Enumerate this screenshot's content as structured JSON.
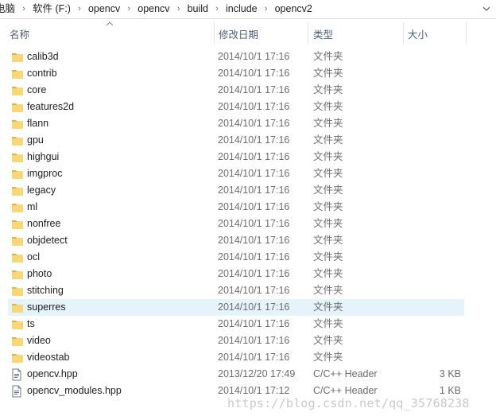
{
  "breadcrumb": [
    "电脑",
    "软件 (F:)",
    "opencv",
    "opencv",
    "build",
    "include",
    "opencv2"
  ],
  "columns": {
    "name": "名称",
    "date": "修改日期",
    "type": "类型",
    "size": "大小"
  },
  "files": [
    {
      "name": "calib3d",
      "date": "2014/10/1 17:16",
      "type": "文件夹",
      "size": "",
      "kind": "folder"
    },
    {
      "name": "contrib",
      "date": "2014/10/1 17:16",
      "type": "文件夹",
      "size": "",
      "kind": "folder"
    },
    {
      "name": "core",
      "date": "2014/10/1 17:16",
      "type": "文件夹",
      "size": "",
      "kind": "folder"
    },
    {
      "name": "features2d",
      "date": "2014/10/1 17:16",
      "type": "文件夹",
      "size": "",
      "kind": "folder"
    },
    {
      "name": "flann",
      "date": "2014/10/1 17:16",
      "type": "文件夹",
      "size": "",
      "kind": "folder"
    },
    {
      "name": "gpu",
      "date": "2014/10/1 17:16",
      "type": "文件夹",
      "size": "",
      "kind": "folder"
    },
    {
      "name": "highgui",
      "date": "2014/10/1 17:16",
      "type": "文件夹",
      "size": "",
      "kind": "folder"
    },
    {
      "name": "imgproc",
      "date": "2014/10/1 17:16",
      "type": "文件夹",
      "size": "",
      "kind": "folder"
    },
    {
      "name": "legacy",
      "date": "2014/10/1 17:16",
      "type": "文件夹",
      "size": "",
      "kind": "folder"
    },
    {
      "name": "ml",
      "date": "2014/10/1 17:16",
      "type": "文件夹",
      "size": "",
      "kind": "folder"
    },
    {
      "name": "nonfree",
      "date": "2014/10/1 17:16",
      "type": "文件夹",
      "size": "",
      "kind": "folder"
    },
    {
      "name": "objdetect",
      "date": "2014/10/1 17:16",
      "type": "文件夹",
      "size": "",
      "kind": "folder"
    },
    {
      "name": "ocl",
      "date": "2014/10/1 17:16",
      "type": "文件夹",
      "size": "",
      "kind": "folder"
    },
    {
      "name": "photo",
      "date": "2014/10/1 17:16",
      "type": "文件夹",
      "size": "",
      "kind": "folder"
    },
    {
      "name": "stitching",
      "date": "2014/10/1 17:16",
      "type": "文件夹",
      "size": "",
      "kind": "folder"
    },
    {
      "name": "superres",
      "date": "2014/10/1 17:16",
      "type": "文件夹",
      "size": "",
      "kind": "folder",
      "hovered": true
    },
    {
      "name": "ts",
      "date": "2014/10/1 17:16",
      "type": "文件夹",
      "size": "",
      "kind": "folder"
    },
    {
      "name": "video",
      "date": "2014/10/1 17:16",
      "type": "文件夹",
      "size": "",
      "kind": "folder"
    },
    {
      "name": "videostab",
      "date": "2014/10/1 17:16",
      "type": "文件夹",
      "size": "",
      "kind": "folder"
    },
    {
      "name": "opencv.hpp",
      "date": "2013/12/20 17:49",
      "type": "C/C++ Header",
      "size": "3 KB",
      "kind": "file"
    },
    {
      "name": "opencv_modules.hpp",
      "date": "2014/10/1 17:12",
      "type": "C/C++ Header",
      "size": "1 KB",
      "kind": "file"
    }
  ],
  "icons": {
    "folder": "folder-icon",
    "file": "header-file-icon",
    "separator": "chevron-right-icon",
    "dropdown": "chevron-down-icon",
    "sort": "sort-ascending-icon"
  },
  "colors": {
    "folder": "#f8d775",
    "folder_dark": "#e8b23a",
    "header_text": "#4c607a",
    "hover_row": "#e5f3fb"
  },
  "watermark": "https://blog.csdn.net/qq_35768238"
}
